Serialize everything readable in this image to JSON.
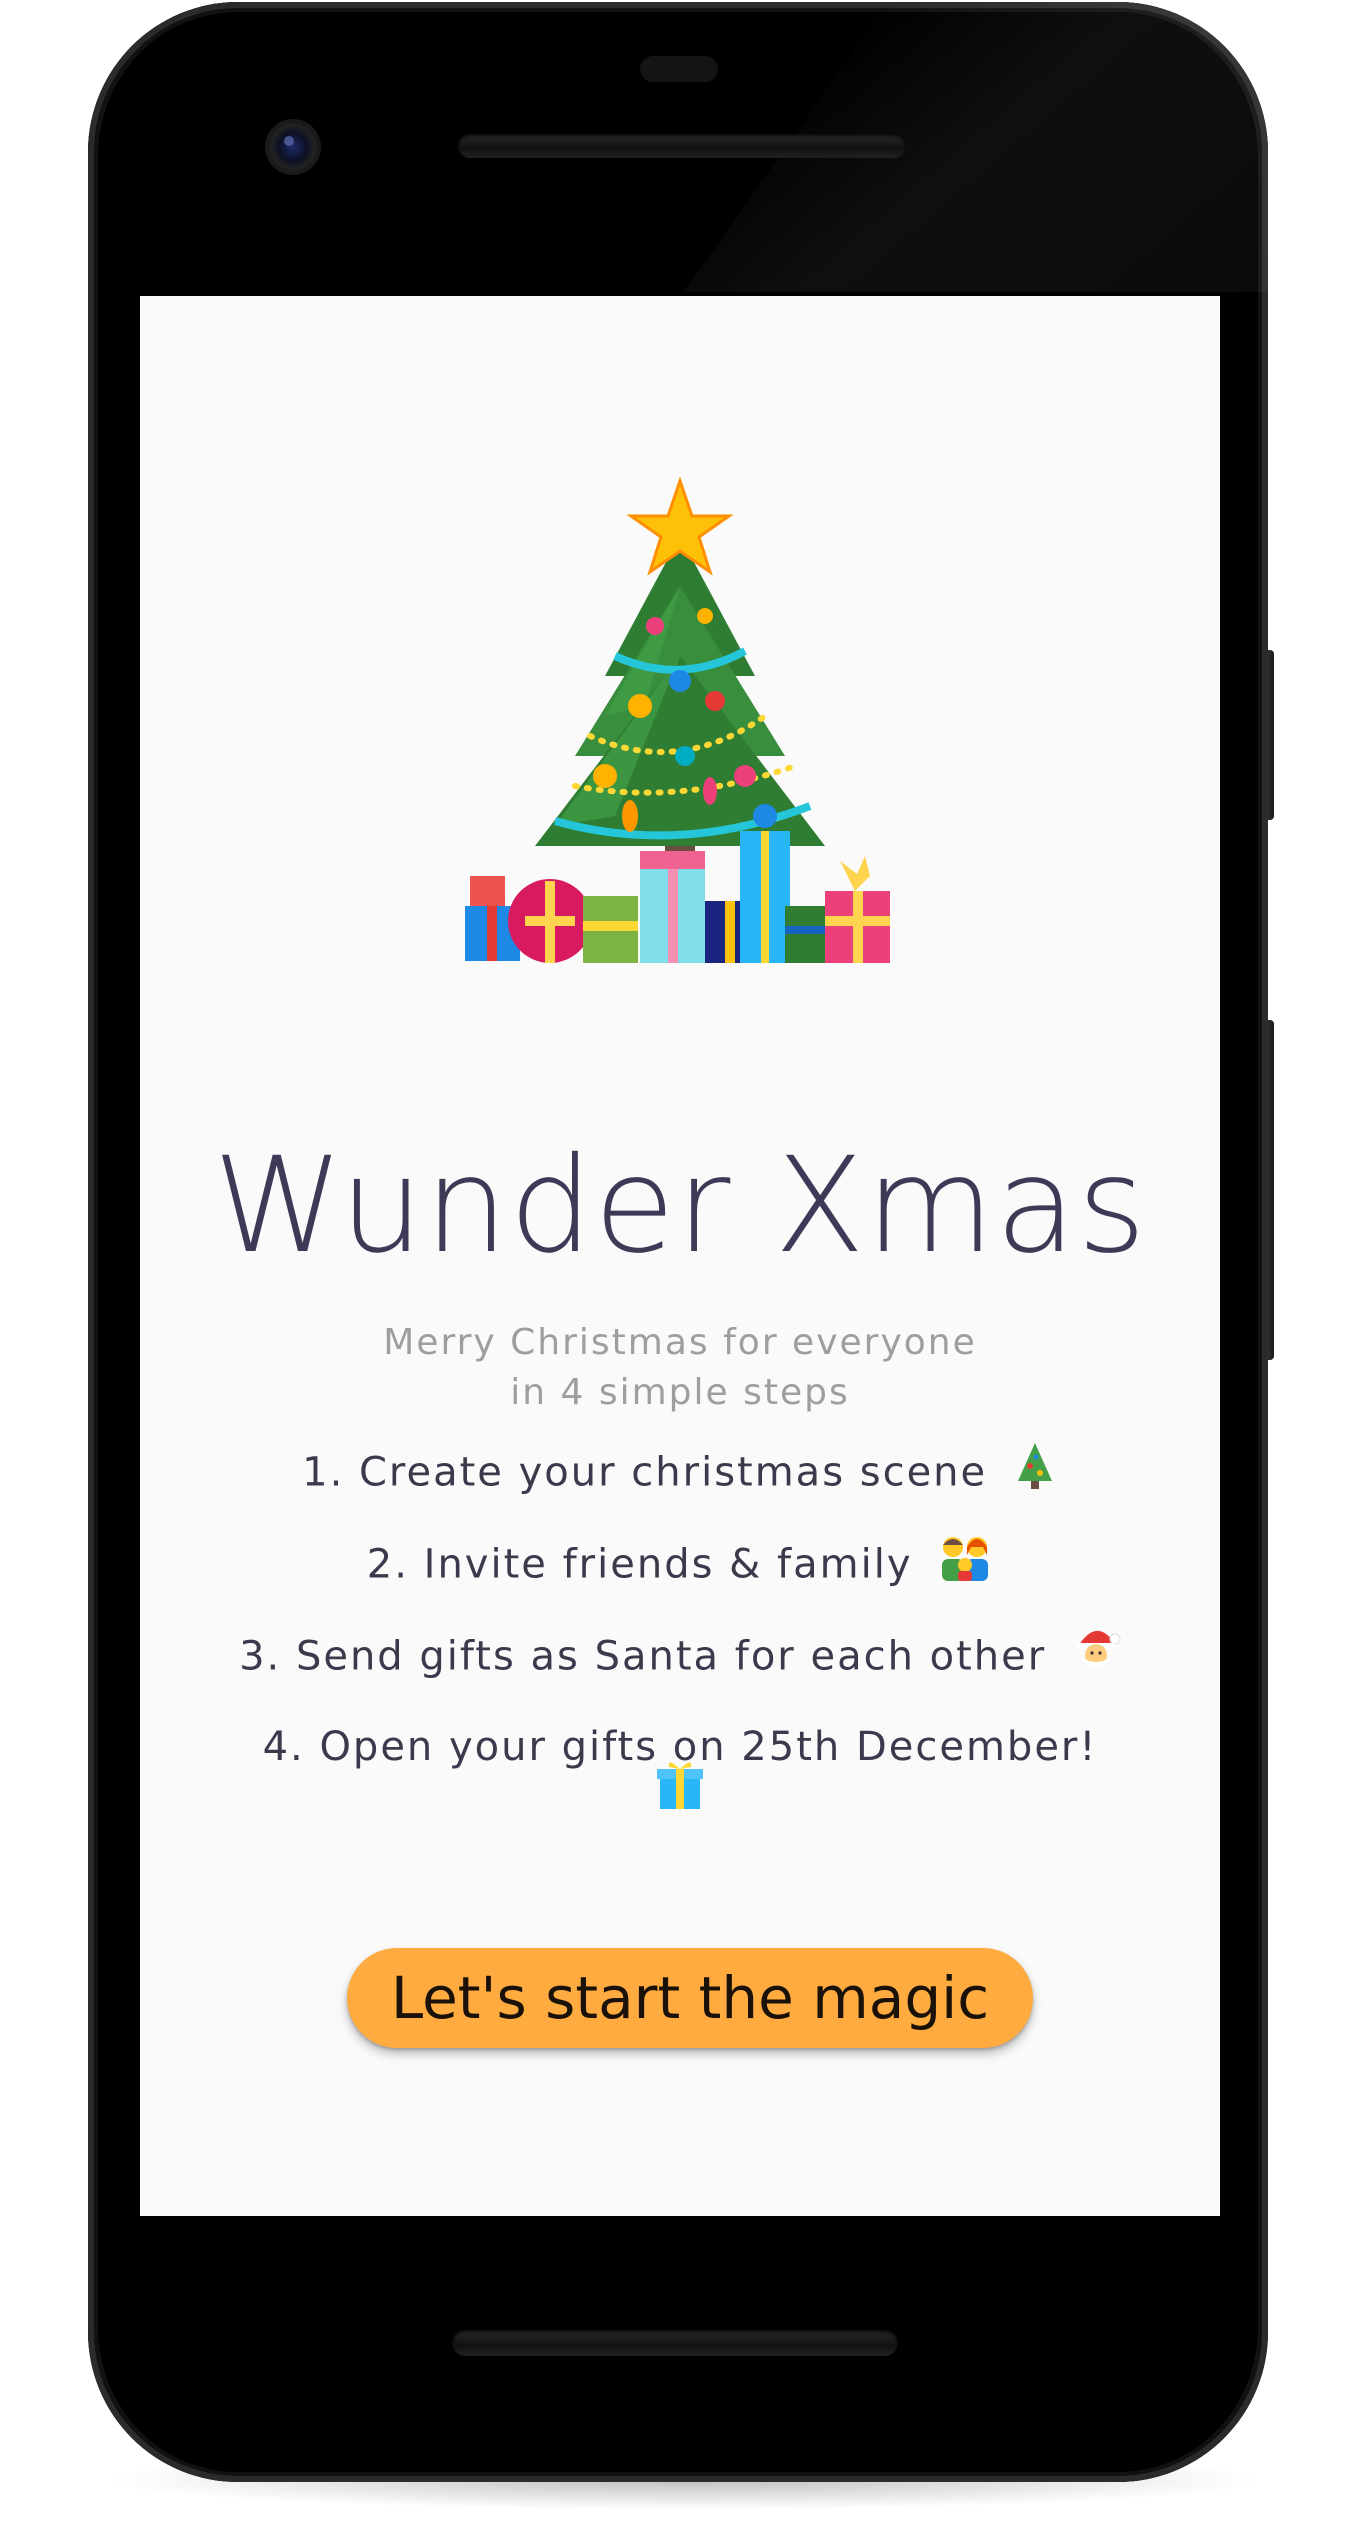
{
  "app": {
    "title": "Wunder Xmas",
    "subtitle_line1": "Merry Christmas for everyone",
    "subtitle_line2": "in 4 simple steps"
  },
  "steps": [
    {
      "text": "1. Create your christmas scene",
      "icon": "christmas-tree-emoji"
    },
    {
      "text": "2. Invite friends & family",
      "icon": "family-emoji"
    },
    {
      "text": "3. Send gifts as Santa for each other",
      "icon": "santa-emoji"
    },
    {
      "text": "4. Open your gifts on 25th December!",
      "icon": "gift-emoji"
    }
  ],
  "cta": {
    "label": "Let's start the magic",
    "color": "#ffab40"
  },
  "colors": {
    "background": "#fafafa",
    "title": "#3c3a56",
    "subtitle": "#9e9e9e",
    "steps": "#3a3a4c"
  },
  "hero_image": {
    "icon": "christmas-tree-with-gifts"
  }
}
